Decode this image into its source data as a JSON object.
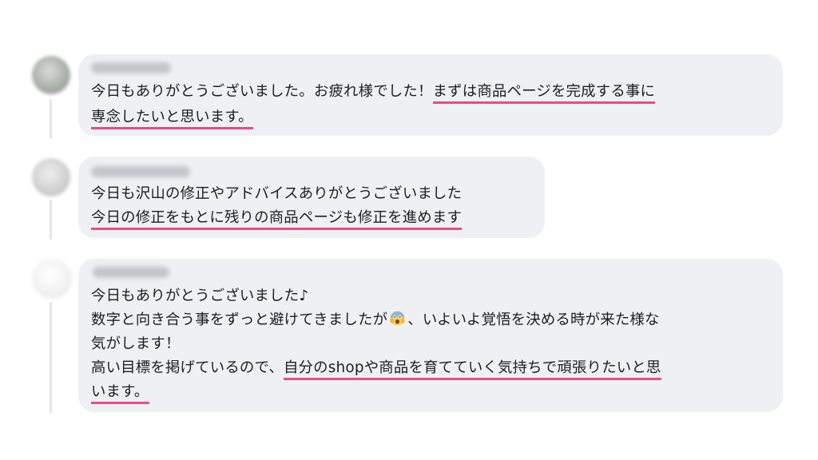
{
  "comments": [
    {
      "lines": [
        [
          {
            "text": "今日もありがとうございました。お疲れ様でした！",
            "hl": false
          },
          {
            "text": "まずは商品ページを完成する事に",
            "hl": true
          }
        ],
        [
          {
            "text": "専念したいと思います。",
            "hl": true
          }
        ]
      ]
    },
    {
      "lines": [
        [
          {
            "text": "今日も沢山の修正やアドバイスありがとうございました",
            "hl": false
          }
        ],
        [
          {
            "text": "今日の修正をもとに残りの商品ページも修正を進めます",
            "hl": true
          }
        ]
      ]
    },
    {
      "lines": [
        [
          {
            "text": "今日もありがとうございました♪",
            "hl": false
          }
        ],
        [
          {
            "text": "数字と向き合う事をずっと避けてきましたが",
            "hl": false
          },
          {
            "emoji": "scared-face-emoji"
          },
          {
            "text": "、いよいよ覚悟を決める時が来た様な",
            "hl": false
          }
        ],
        [
          {
            "text": "気がします！",
            "hl": false
          }
        ],
        [
          {
            "text": "高い目標を掲げているので、",
            "hl": false
          },
          {
            "text": "自分のshopや商品を育てていく気持ちで頑張りたいと思",
            "hl": true
          }
        ],
        [
          {
            "text": "います。",
            "hl": true
          }
        ]
      ]
    }
  ],
  "colors": {
    "bubble": "#eff0f4",
    "highlight": "#ec4a86",
    "text": "#1c1e21",
    "thread_line": "#e4e6eb"
  }
}
